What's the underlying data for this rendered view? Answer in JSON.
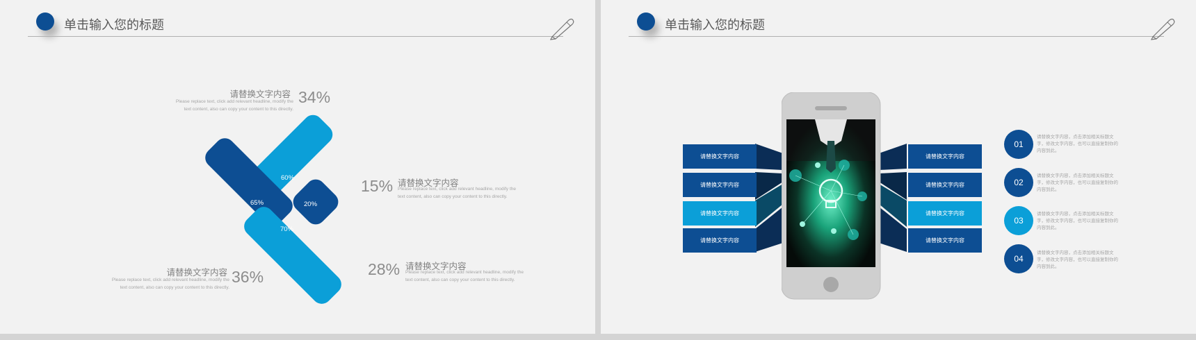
{
  "header": {
    "title": "单击输入您的标题"
  },
  "left_slide": {
    "blocks": [
      {
        "label": "请替换文字内容",
        "desc": "Please replace text, click add relevant headline, modify the text content, also can copy your content to this directly.",
        "percent": "34%"
      },
      {
        "label": "请替换文字内容",
        "desc": "Please replace text, click add relevant headline, modify the text content, also can copy your content to this directly.",
        "percent": "15%"
      },
      {
        "label": "请替换文字内容",
        "desc": "Please replace text, click add relevant headline, modify the text content, also can copy your content to this directly.",
        "percent": "36%"
      },
      {
        "label": "请替换文字内容",
        "desc": "Please replace text, click add relevant headline, modify the text content, also can copy your content to this directly.",
        "percent": "28%"
      }
    ],
    "tiles": [
      {
        "value": "60%"
      },
      {
        "value": "65%"
      },
      {
        "value": "20%"
      },
      {
        "value": "70%"
      }
    ]
  },
  "right_slide": {
    "left_boxes": [
      "请替换文字内容",
      "请替换文字内容",
      "请替换文字内容",
      "请替换文字内容"
    ],
    "right_boxes": [
      "请替换文字内容",
      "请替换文字内容",
      "请替换文字内容",
      "请替换文字内容"
    ],
    "numbers": [
      {
        "num": "01",
        "text": "请替换文字内容，点击添加相关标题文字，修改文字内容，也可以直接复制你的内容到此。"
      },
      {
        "num": "02",
        "text": "请替换文字内容，点击添加相关标题文字，修改文字内容，也可以直接复制你的内容到此。"
      },
      {
        "num": "03",
        "text": "请替换文字内容，点击添加相关标题文字，修改文字内容，也可以直接复制你的内容到此。"
      },
      {
        "num": "04",
        "text": "请替换文字内容，点击添加相关标题文字，修改文字内容，也可以直接复制你的内容到此。"
      }
    ]
  },
  "colors": {
    "dark_blue": "#0d4e93",
    "light_blue": "#0b9fd8",
    "bg": "#f2f2f2"
  }
}
